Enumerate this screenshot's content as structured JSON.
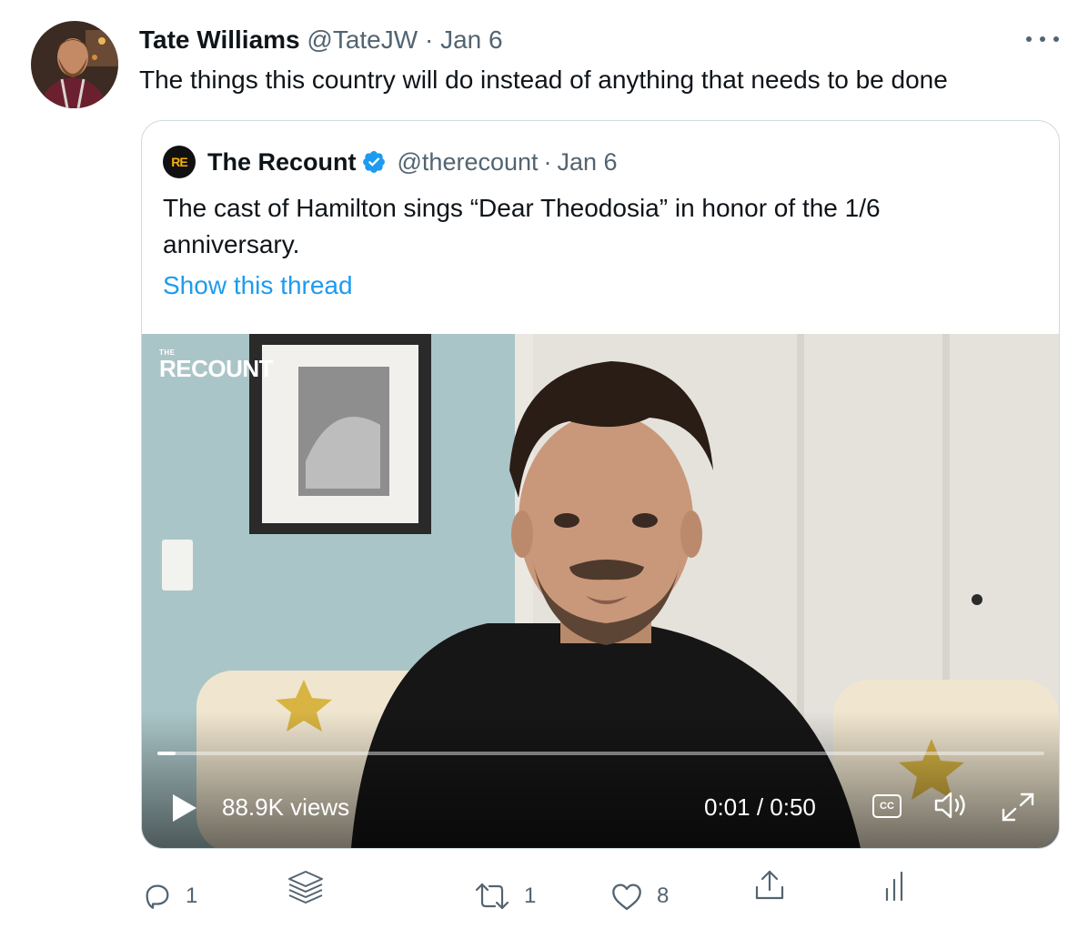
{
  "tweet": {
    "author_name": "Tate Williams",
    "author_handle": "@TateJW",
    "separator": "·",
    "date": "Jan 6",
    "text": "The things this country will do instead of anything that needs to be done"
  },
  "quoted": {
    "logo_text": "RE",
    "author_name": "The Recount",
    "author_handle": "@therecount",
    "separator": "·",
    "date": "Jan 6",
    "text": "The cast of Hamilton sings “Dear Theodosia” in honor of the 1/6 anniversary.",
    "show_thread": "Show this thread",
    "verified": true
  },
  "video": {
    "watermark_small": "THE",
    "watermark_big": "RECOUNT",
    "views": "88.9K views",
    "time": "0:01 / 0:50",
    "cc_label": "CC",
    "progress_fraction": 0.02
  },
  "actions": {
    "reply_count": "1",
    "retweet_count": "1",
    "like_count": "8"
  },
  "colors": {
    "accent": "#1d9bf0",
    "text_primary": "#0f1419",
    "text_secondary": "#536471",
    "border": "#cfd9de"
  },
  "icons": [
    "more-icon",
    "verified-icon",
    "play-icon",
    "closed-captions-icon",
    "volume-icon",
    "fullscreen-icon",
    "reply-icon",
    "layers-icon",
    "retweet-icon",
    "like-icon",
    "share-icon",
    "analytics-icon"
  ]
}
